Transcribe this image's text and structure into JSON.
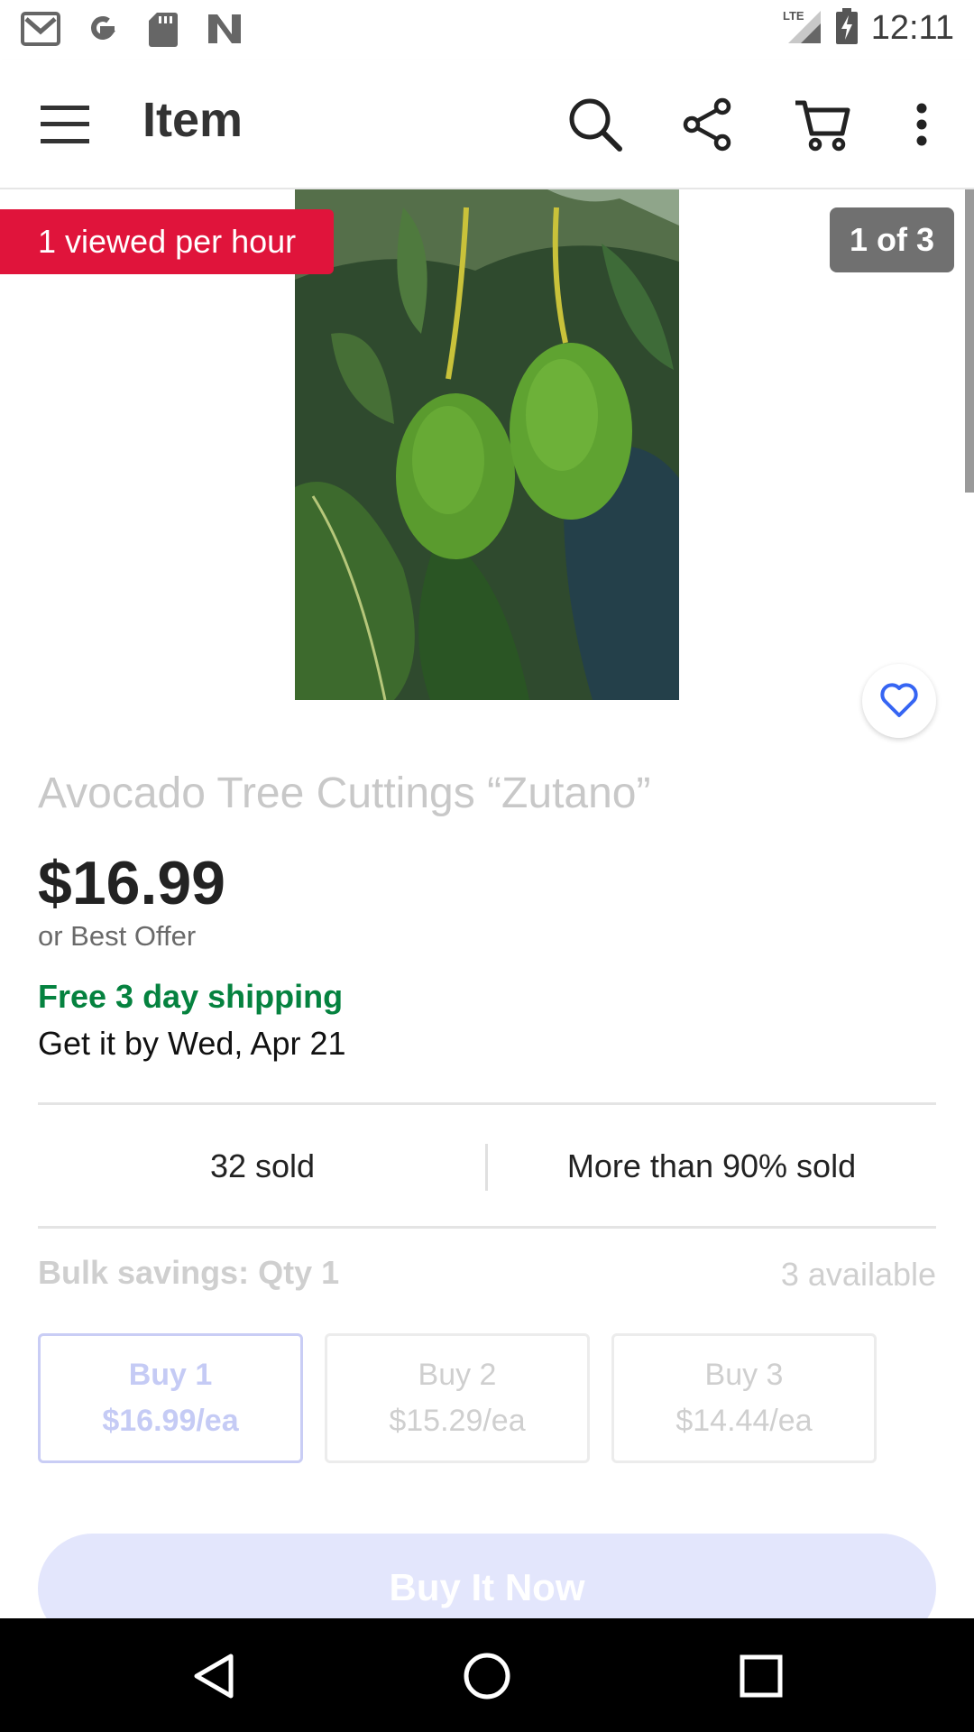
{
  "status_bar": {
    "time": "12:11",
    "network": "LTE",
    "left_icons": [
      "gmail-icon",
      "google-icon",
      "sd-card-icon",
      "n-app-icon"
    ]
  },
  "app_bar": {
    "title": "Item",
    "actions": [
      "search-icon",
      "share-icon",
      "cart-icon",
      "more-vert-icon"
    ]
  },
  "gallery": {
    "views_badge": "1 viewed per hour",
    "page_indicator": "1 of 3"
  },
  "listing": {
    "title": "Avocado Tree Cuttings “Zutano”",
    "price": "$16.99",
    "offer": "or Best Offer",
    "shipping": "Free 3 day shipping",
    "delivery": "Get it by Wed, Apr 21"
  },
  "stats": {
    "sold": "32 sold",
    "sold_percent": "More than 90% sold"
  },
  "bulk": {
    "label": "Bulk savings: Qty 1",
    "available": "3 available",
    "options": [
      {
        "qty": "Buy 1",
        "price": "$16.99/ea",
        "selected": true
      },
      {
        "qty": "Buy 2",
        "price": "$15.29/ea",
        "selected": false
      },
      {
        "qty": "Buy 3",
        "price": "$14.44/ea",
        "selected": false
      }
    ]
  },
  "cta": {
    "buy_now": "Buy It Now"
  },
  "colors": {
    "urgency_red": "#e0143b",
    "shipping_green": "#05823f",
    "heart_blue": "#3665f3",
    "cta_bg": "#e3e6fc"
  }
}
